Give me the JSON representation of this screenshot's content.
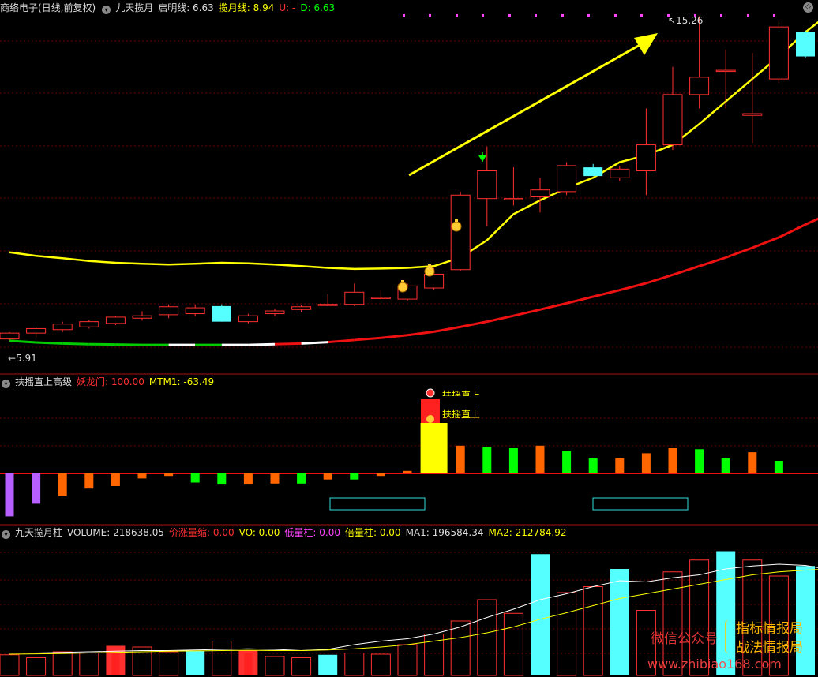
{
  "colors": {
    "up": "#ff3030",
    "down": "#55ffff",
    "ma_yellow": "#ffff00",
    "ma_red": "#ee1111",
    "grid": "#8b0000",
    "bg": "#000000"
  },
  "top": {
    "stock": "商络电子(日线,前复权)",
    "indicator": "九天揽月",
    "qiming": "启明线: 6.63",
    "lanyue": "揽月线: 8.94",
    "u": "U: -",
    "d": "D: 6.63",
    "high_label": "15.26",
    "low_label": "5.91"
  },
  "mid": {
    "title": "扶摇直上高级",
    "yaolong": "妖龙门: 100.00",
    "mtm": "MTM1: -63.49",
    "signal1": "扶摇直上",
    "signal2": "扶摇直上"
  },
  "bottom": {
    "title": "九天揽月柱",
    "volume": "VOLUME: 218638.05",
    "jiazhang": "价涨量缩: 0.00",
    "vo": "VO: 0.00",
    "diliang": "低量柱: 0.00",
    "beiliang": "倍量柱: 0.00",
    "ma1": "MA1: 196584.34",
    "ma2": "MA2: 212784.92"
  },
  "watermark": {
    "wechat": "微信公众号",
    "line1": "指标情报局",
    "line2": "战法情报局",
    "url": "www.zhibiao168.com"
  },
  "chart_data": [
    {
      "type": "candlestick",
      "title": "商络电子(日线,前复权)",
      "ylim": [
        5.6,
        15.5
      ],
      "candles": [
        {
          "o": 5.95,
          "h": 6.15,
          "l": 5.91,
          "c": 6.12
        },
        {
          "o": 6.12,
          "h": 6.3,
          "l": 6.0,
          "c": 6.25
        },
        {
          "o": 6.22,
          "h": 6.45,
          "l": 6.15,
          "c": 6.38
        },
        {
          "o": 6.3,
          "h": 6.5,
          "l": 6.25,
          "c": 6.45
        },
        {
          "o": 6.4,
          "h": 6.62,
          "l": 6.35,
          "c": 6.58
        },
        {
          "o": 6.55,
          "h": 6.75,
          "l": 6.48,
          "c": 6.62
        },
        {
          "o": 6.65,
          "h": 6.95,
          "l": 6.55,
          "c": 6.88
        },
        {
          "o": 6.68,
          "h": 6.95,
          "l": 6.6,
          "c": 6.85
        },
        {
          "o": 6.9,
          "h": 6.95,
          "l": 6.45,
          "c": 6.45
        },
        {
          "o": 6.45,
          "h": 6.68,
          "l": 6.4,
          "c": 6.62
        },
        {
          "o": 6.68,
          "h": 6.82,
          "l": 6.6,
          "c": 6.76
        },
        {
          "o": 6.8,
          "h": 6.92,
          "l": 6.72,
          "c": 6.88
        },
        {
          "o": 6.95,
          "h": 7.25,
          "l": 6.9,
          "c": 6.95
        },
        {
          "o": 6.95,
          "h": 7.55,
          "l": 6.9,
          "c": 7.3
        },
        {
          "o": 7.15,
          "h": 7.35,
          "l": 7.08,
          "c": 7.15
        },
        {
          "o": 7.1,
          "h": 7.55,
          "l": 7.05,
          "c": 7.48
        },
        {
          "o": 7.42,
          "h": 8.0,
          "l": 7.35,
          "c": 7.82
        },
        {
          "o": 7.95,
          "h": 10.2,
          "l": 7.9,
          "c": 10.1
        },
        {
          "o": 10.0,
          "h": 11.5,
          "l": 9.2,
          "c": 10.8
        },
        {
          "o": 10.0,
          "h": 10.9,
          "l": 9.8,
          "c": 10.0
        },
        {
          "o": 10.05,
          "h": 10.6,
          "l": 9.6,
          "c": 10.25
        },
        {
          "o": 10.2,
          "h": 11.05,
          "l": 10.1,
          "c": 10.95
        },
        {
          "o": 10.9,
          "h": 11.0,
          "l": 10.65,
          "c": 10.65
        },
        {
          "o": 10.6,
          "h": 10.95,
          "l": 10.5,
          "c": 10.85
        },
        {
          "o": 10.8,
          "h": 12.6,
          "l": 10.1,
          "c": 11.55
        },
        {
          "o": 11.55,
          "h": 13.8,
          "l": 11.4,
          "c": 13.0
        },
        {
          "o": 13.0,
          "h": 15.26,
          "l": 12.6,
          "c": 13.5
        },
        {
          "o": 13.7,
          "h": 14.3,
          "l": 12.6,
          "c": 13.7
        },
        {
          "o": 12.4,
          "h": 14.2,
          "l": 11.6,
          "c": 12.45
        },
        {
          "o": 13.45,
          "h": 15.15,
          "l": 13.35,
          "c": 14.95
        },
        {
          "o": 14.8,
          "h": 14.85,
          "l": 14.05,
          "c": 14.1
        },
        {
          "o": 14.2,
          "h": 14.45,
          "l": 13.4,
          "c": 13.75
        }
      ],
      "series": [
        {
          "color": "#ffff00",
          "values": [
            8.45,
            8.35,
            8.28,
            8.2,
            8.15,
            8.12,
            8.1,
            8.12,
            8.15,
            8.13,
            8.1,
            8.05,
            8.0,
            7.97,
            7.98,
            8.0,
            8.05,
            8.3,
            8.8,
            9.55,
            9.95,
            10.3,
            10.6,
            11.05,
            11.25,
            11.55,
            12.15,
            12.8,
            13.45,
            14.1,
            14.8,
            15.4
          ]
        },
        {
          "colors": [
            "#00cc00",
            "#ffffff",
            "#ee1111"
          ],
          "values": [
            5.9,
            5.85,
            5.82,
            5.8,
            5.79,
            5.78,
            5.78,
            5.78,
            5.78,
            5.78,
            5.8,
            5.82,
            5.86,
            5.92,
            5.98,
            6.06,
            6.16,
            6.3,
            6.45,
            6.62,
            6.8,
            6.98,
            7.17,
            7.36,
            7.56,
            7.8,
            8.05,
            8.3,
            8.58,
            8.88,
            9.25,
            9.6
          ]
        }
      ]
    },
    {
      "type": "bar",
      "title": "扶摇直上高级",
      "ylim": [
        -100,
        110
      ],
      "values": [
        -85,
        -60,
        -45,
        -30,
        -25,
        -10,
        -5,
        -18,
        -22,
        -22,
        -20,
        -20,
        -12,
        -12,
        -5,
        5,
        100,
        55,
        52,
        50,
        55,
        45,
        30,
        30,
        40,
        50,
        48,
        30,
        42,
        25,
        0,
        0
      ],
      "colors": [
        "#b860ff",
        "#b860ff",
        "#ff6600",
        "#ff6600",
        "#ff6600",
        "#ff6600",
        "#ff6600",
        "#00ff00",
        "#00ff00",
        "#ff6600",
        "#ff6600",
        "#00ff00",
        "#ff6600",
        "#00ff00",
        "#ff6600",
        "#ff6600",
        "#ffff00",
        "#ff6600",
        "#00ff00",
        "#00ff00",
        "#ff6600",
        "#00ff00",
        "#00ff00",
        "#ff6600",
        "#ff6600",
        "#ff6600",
        "#00ff00",
        "#00ff00",
        "#ff6600",
        "#00ff00",
        "#ff6600",
        "#ff6600"
      ]
    },
    {
      "type": "bar",
      "title": "九天揽月柱",
      "ylim": [
        0,
        240000
      ],
      "values": [
        35000,
        30000,
        40000,
        38000,
        50000,
        48000,
        40000,
        42000,
        58000,
        42000,
        32000,
        30000,
        35000,
        38000,
        36000,
        52000,
        70000,
        92000,
        128000,
        105000,
        205000,
        140000,
        150000,
        180000,
        110000,
        175000,
        195000,
        210000,
        195000,
        168000,
        185000,
        210000
      ],
      "colors": [
        "#ff3030",
        "#ff3030",
        "#ff3030",
        "#ff3030",
        "#ff3030",
        "#ff3030",
        "#ff3030",
        "#55ffff",
        "#ff3030",
        "#ff3030",
        "#ff3030",
        "#ff3030",
        "#55ffff",
        "#ff3030",
        "#ff3030",
        "#ff3030",
        "#ff3030",
        "#ff3030",
        "#ff3030",
        "#ff3030",
        "#55ffff",
        "#ff3030",
        "#ff3030",
        "#55ffff",
        "#ff3030",
        "#ff3030",
        "#ff3030",
        "#55ffff",
        "#ff3030",
        "#ff3030",
        "#55ffff",
        "#55ffff"
      ],
      "filled": [
        false,
        false,
        false,
        false,
        true,
        false,
        false,
        true,
        false,
        true,
        false,
        false,
        true,
        false,
        false,
        false,
        false,
        false,
        false,
        false,
        true,
        false,
        false,
        true,
        false,
        false,
        false,
        true,
        false,
        false,
        true,
        true
      ],
      "series": [
        {
          "name": "MA1",
          "color": "#ffffff",
          "values": [
            38000,
            38000,
            39000,
            40000,
            41000,
            42000,
            42000,
            43000,
            44000,
            45000,
            44000,
            42000,
            44000,
            52000,
            58000,
            62000,
            70000,
            82000,
            98000,
            112000,
            128000,
            138000,
            150000,
            160000,
            158000,
            165000,
            170000,
            180000,
            185000,
            188000,
            186000,
            178000
          ]
        },
        {
          "name": "MA2",
          "color": "#ffff00",
          "values": [
            36000,
            36500,
            37000,
            38000,
            39000,
            40000,
            41000,
            41500,
            42000,
            42500,
            42000,
            42000,
            43000,
            45000,
            48000,
            52000,
            58000,
            64000,
            72000,
            82000,
            95000,
            106000,
            118000,
            130000,
            138000,
            146000,
            154000,
            162000,
            170000,
            175000,
            178000,
            180000
          ]
        }
      ]
    }
  ]
}
